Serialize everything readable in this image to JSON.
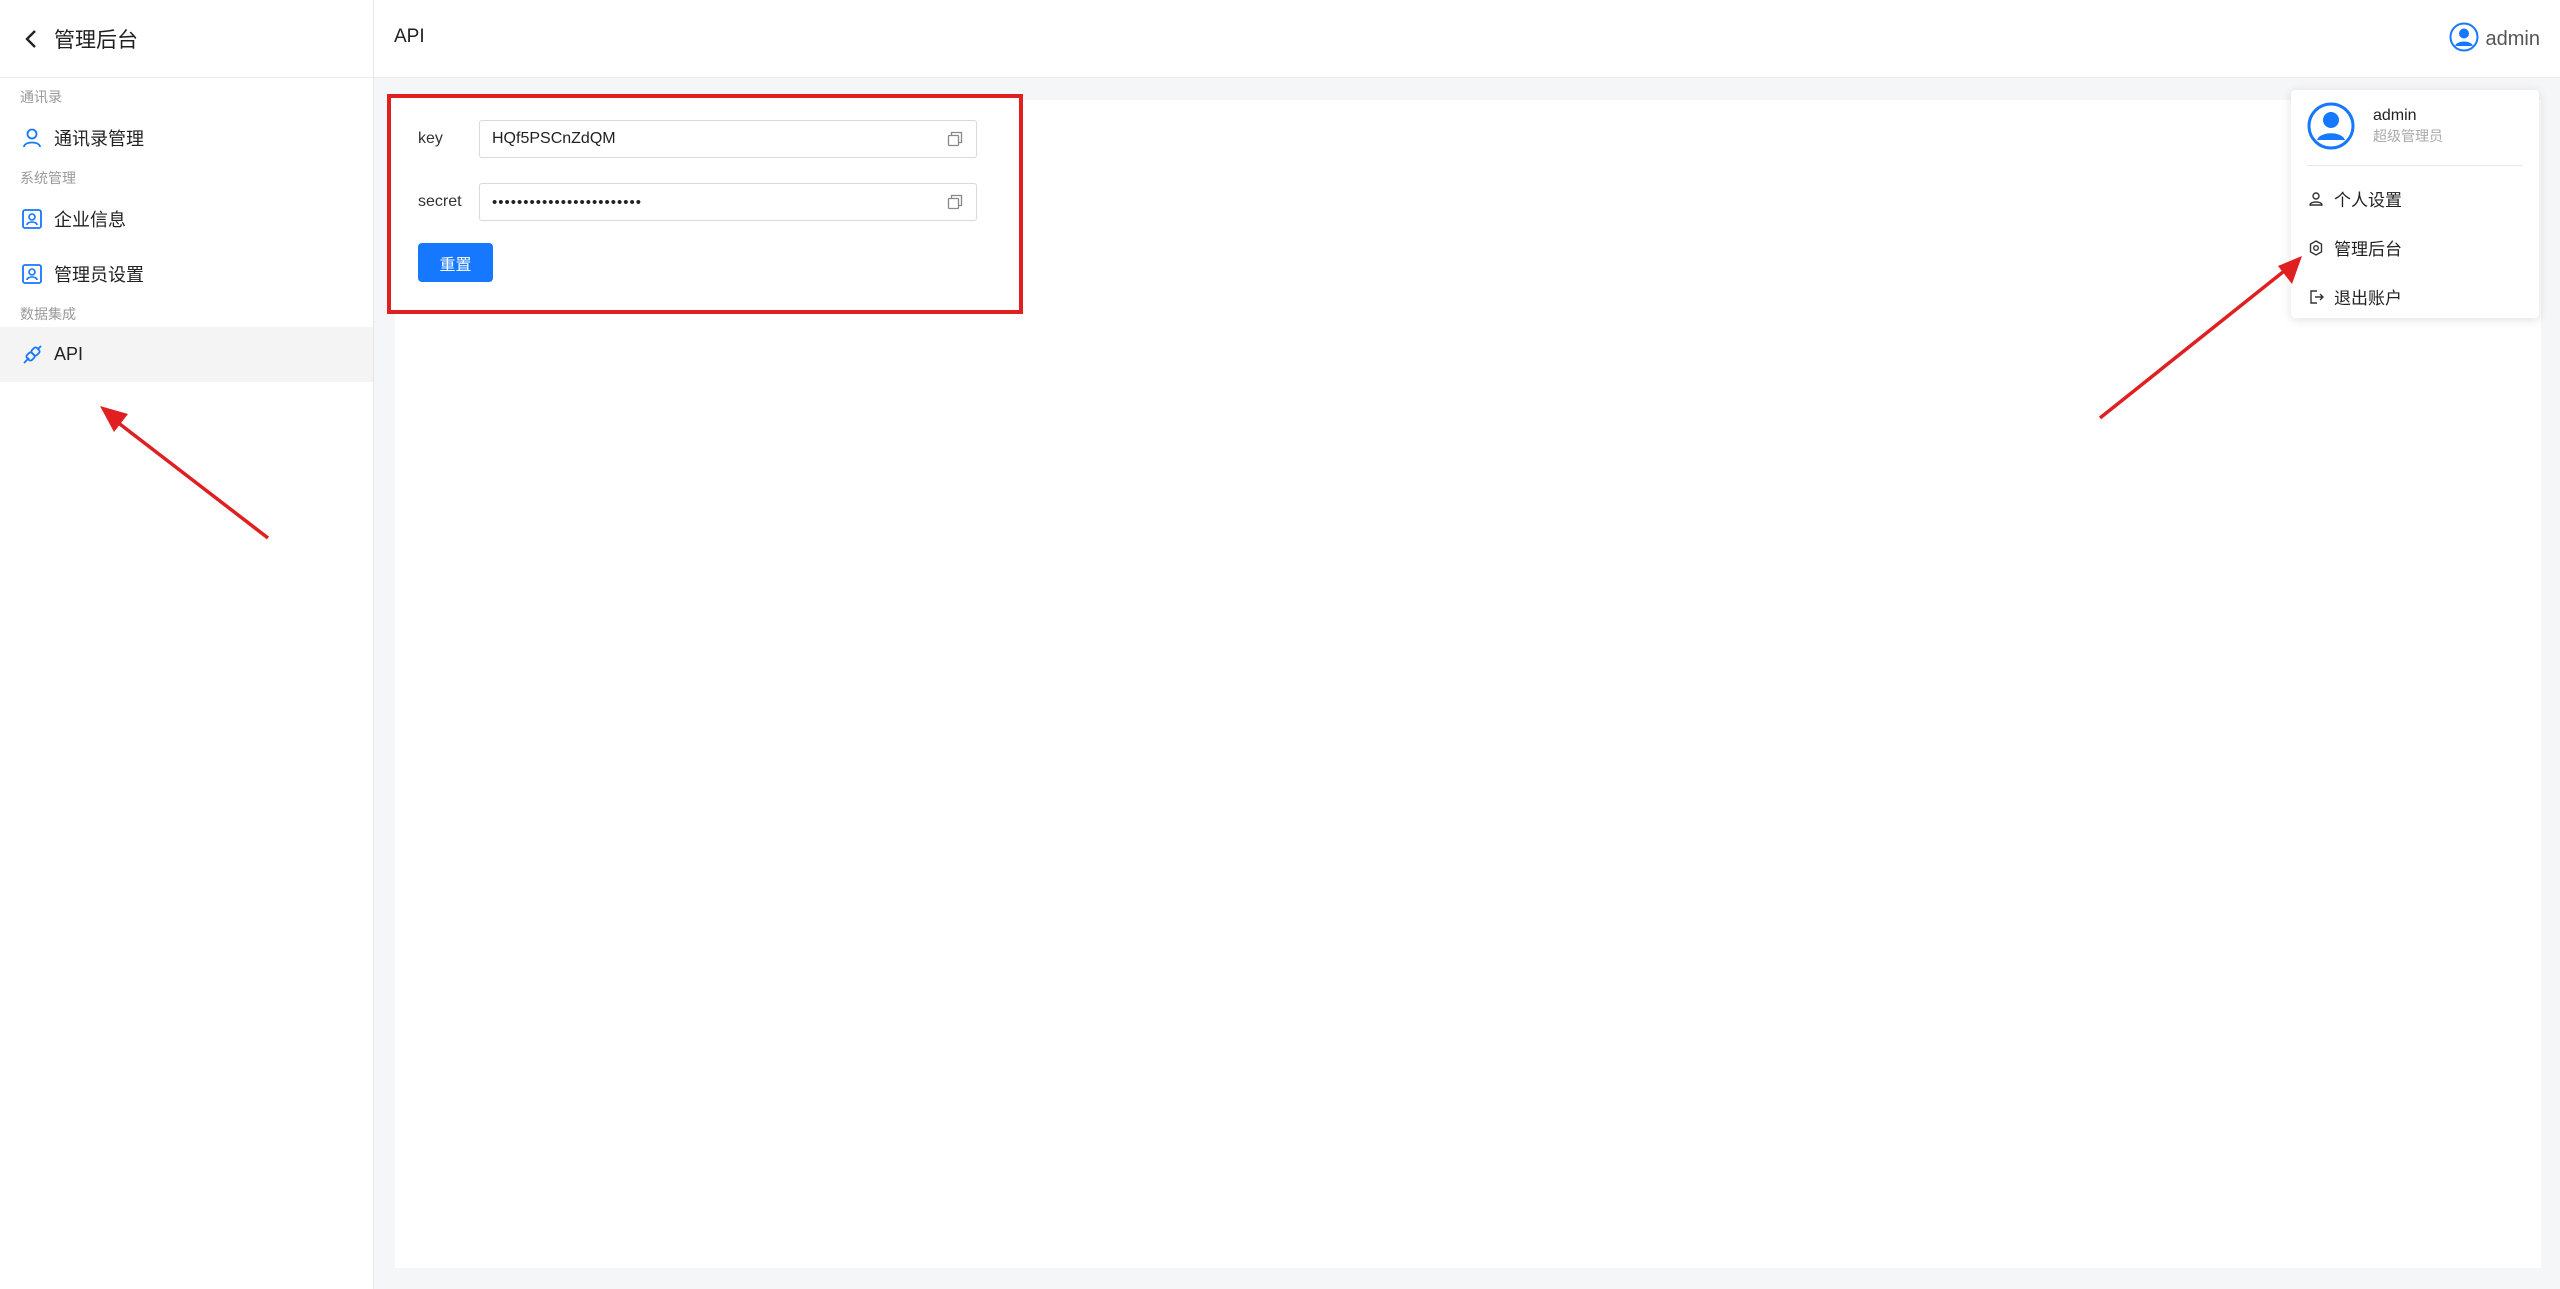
{
  "sidebar": {
    "title": "管理后台",
    "sections": [
      {
        "label": "通讯录",
        "items": [
          {
            "label": "通讯录管理"
          }
        ]
      },
      {
        "label": "系统管理",
        "items": [
          {
            "label": "企业信息"
          },
          {
            "label": "管理员设置"
          }
        ]
      },
      {
        "label": "数据集成",
        "items": [
          {
            "label": "API"
          }
        ]
      }
    ]
  },
  "header": {
    "title": "API",
    "username": "admin"
  },
  "api_form": {
    "key_label": "key",
    "key_value": "HQf5PSCnZdQM",
    "secret_label": "secret",
    "secret_value": "••••••••••••••••••••••••",
    "reset_label": "重置"
  },
  "dropdown": {
    "name": "admin",
    "role": "超级管理员",
    "items": [
      {
        "label": "个人设置"
      },
      {
        "label": "管理后台"
      },
      {
        "label": "退出账户"
      }
    ]
  },
  "colors": {
    "accent": "#1677ff",
    "highlight_box": "#e02020",
    "arrow": "#e02020"
  }
}
